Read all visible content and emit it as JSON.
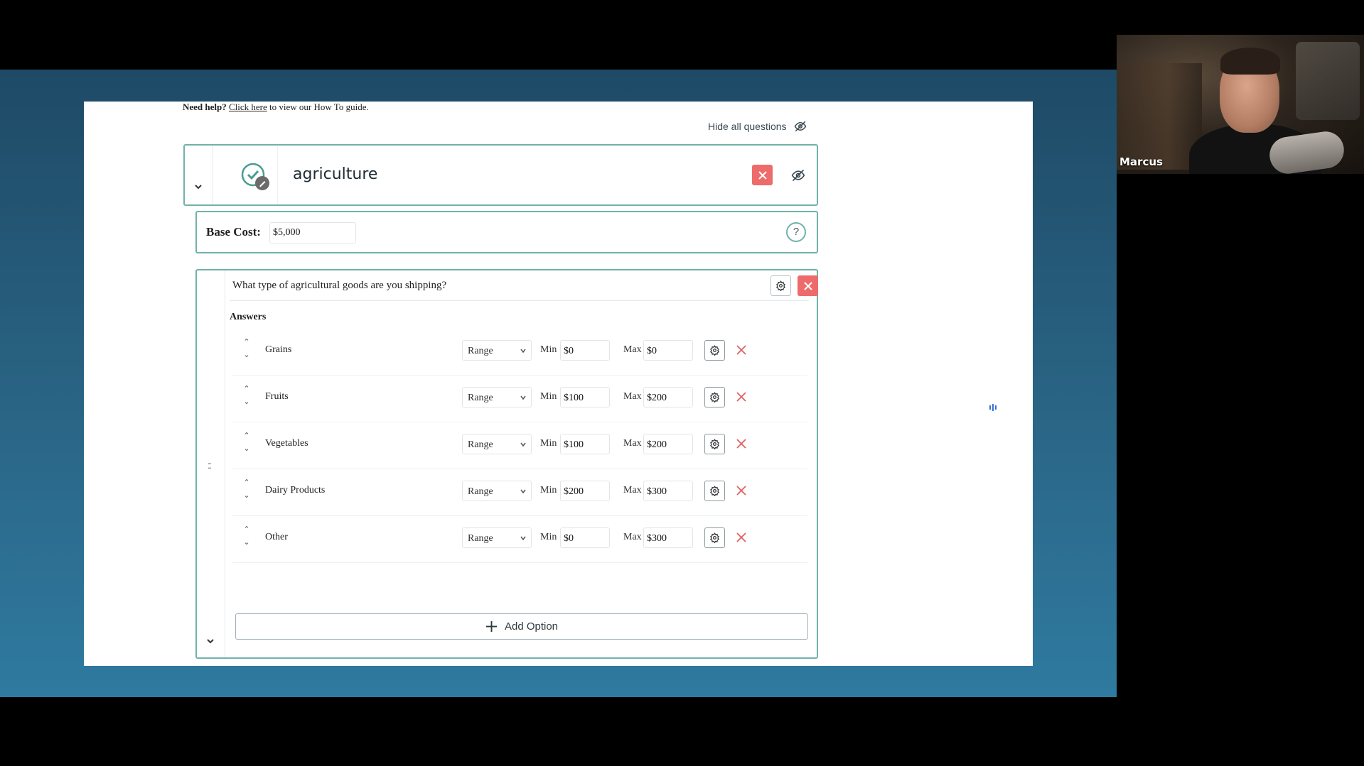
{
  "help": {
    "prefix": "Need help?",
    "link": "Click here",
    "suffix": "to view our How To guide."
  },
  "toolbar": {
    "hide_all_label": "Hide all questions"
  },
  "category": {
    "title": "agriculture"
  },
  "base_cost": {
    "label": "Base Cost:",
    "value": "$5,000",
    "help_glyph": "?"
  },
  "question": {
    "text": "What type of agricultural goods are you shipping?",
    "answers_label": "Answers",
    "rows": [
      {
        "name": "Grains",
        "type": "Range",
        "min_label": "Min",
        "min": "$0",
        "max_label": "Max",
        "max": "$0"
      },
      {
        "name": "Fruits",
        "type": "Range",
        "min_label": "Min",
        "min": "$100",
        "max_label": "Max",
        "max": "$200"
      },
      {
        "name": "Vegetables",
        "type": "Range",
        "min_label": "Min",
        "min": "$100",
        "max_label": "Max",
        "max": "$200"
      },
      {
        "name": "Dairy Products",
        "type": "Range",
        "min_label": "Min",
        "min": "$200",
        "max_label": "Max",
        "max": "$300"
      },
      {
        "name": "Other",
        "type": "Range",
        "min_label": "Min",
        "min": "$0",
        "max_label": "Max",
        "max": "$300"
      }
    ],
    "add_option_label": "Add Option",
    "drag_handle": "::"
  },
  "webcam": {
    "participant_name": "Marcus"
  },
  "colors": {
    "accent": "#6fb3aa",
    "danger": "#ee6b6b",
    "voice": "#3b6fd8"
  }
}
